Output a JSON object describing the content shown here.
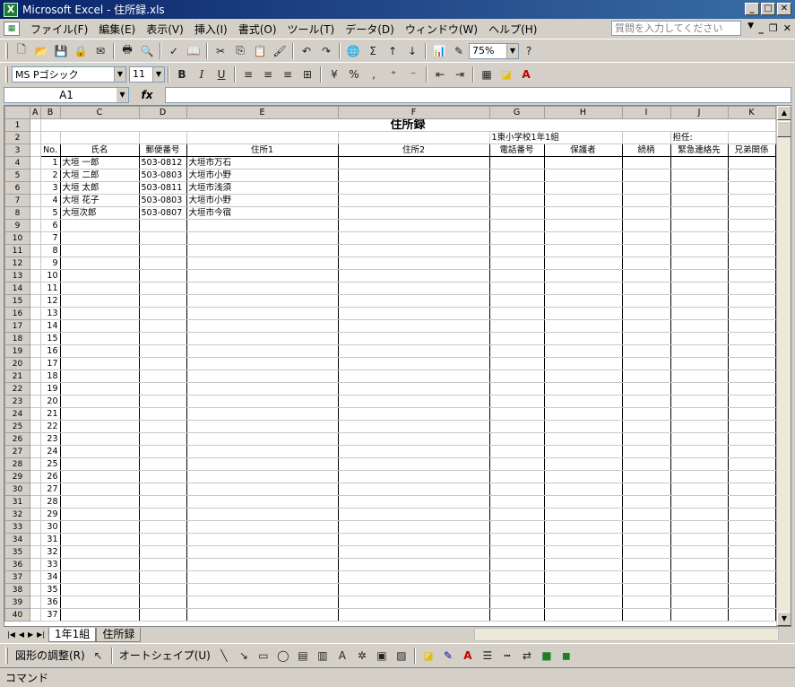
{
  "window": {
    "title": "Microsoft Excel - 住所録.xls",
    "app_icon": "excel-icon"
  },
  "menu": [
    "ファイル(F)",
    "編集(E)",
    "表示(V)",
    "挿入(I)",
    "書式(O)",
    "ツール(T)",
    "データ(D)",
    "ウィンドウ(W)",
    "ヘルプ(H)"
  ],
  "help": {
    "placeholder": "質問を入力してください"
  },
  "toolbar": {
    "zoom": "75%",
    "font_name": "MS Pゴシック",
    "font_size": "11"
  },
  "formula": {
    "name_box": "A1",
    "fx_label": "fx",
    "value": ""
  },
  "columns": [
    "A",
    "B",
    "C",
    "D",
    "E",
    "F",
    "G",
    "H",
    "I",
    "J",
    "K"
  ],
  "sheet": {
    "title": "住所録",
    "school": "1東小学校1年1組",
    "teacher_label": "担任:",
    "headers": [
      "No.",
      "氏名",
      "郵便番号",
      "住所1",
      "住所2",
      "電話番号",
      "保護者",
      "続柄",
      "緊急連絡先",
      "兄弟関係"
    ],
    "rows": [
      {
        "no": "1",
        "name": "大垣 一郎",
        "zip": "503-0812",
        "addr1": "大垣市万石"
      },
      {
        "no": "2",
        "name": "大垣 二郎",
        "zip": "503-0803",
        "addr1": "大垣市小野"
      },
      {
        "no": "3",
        "name": "大垣 太郎",
        "zip": "503-0811",
        "addr1": "大垣市浅須"
      },
      {
        "no": "4",
        "name": "大垣 花子",
        "zip": "503-0803",
        "addr1": "大垣市小野"
      },
      {
        "no": "5",
        "name": "大垣次郎",
        "zip": "503-0807",
        "addr1": "大垣市今宿"
      }
    ],
    "row_numbers": [
      "1",
      "2",
      "3",
      "4",
      "5",
      "6",
      "7",
      "8",
      "9",
      "10",
      "11",
      "12",
      "13",
      "14",
      "15",
      "16",
      "17",
      "18",
      "19",
      "20",
      "21",
      "22",
      "23",
      "24",
      "25",
      "26",
      "27",
      "28",
      "29",
      "30",
      "31",
      "32",
      "33",
      "34",
      "35",
      "36",
      "37",
      "38",
      "39",
      "40"
    ],
    "empty_numbers": [
      "6",
      "7",
      "8",
      "9",
      "10",
      "11",
      "12",
      "13",
      "14",
      "15",
      "16",
      "17",
      "18",
      "19",
      "20",
      "21",
      "22",
      "23",
      "24",
      "25",
      "26",
      "27",
      "28",
      "29",
      "30",
      "31",
      "32",
      "33",
      "34",
      "35",
      "36",
      "37"
    ]
  },
  "tabs": [
    {
      "label": "1年1組",
      "active": true
    },
    {
      "label": "住所録",
      "active": false
    }
  ],
  "drawing": {
    "adjust_label": "図形の調整(R)",
    "autoshape_label": "オートシェイプ(U)"
  },
  "status": {
    "text": "コマンド"
  }
}
